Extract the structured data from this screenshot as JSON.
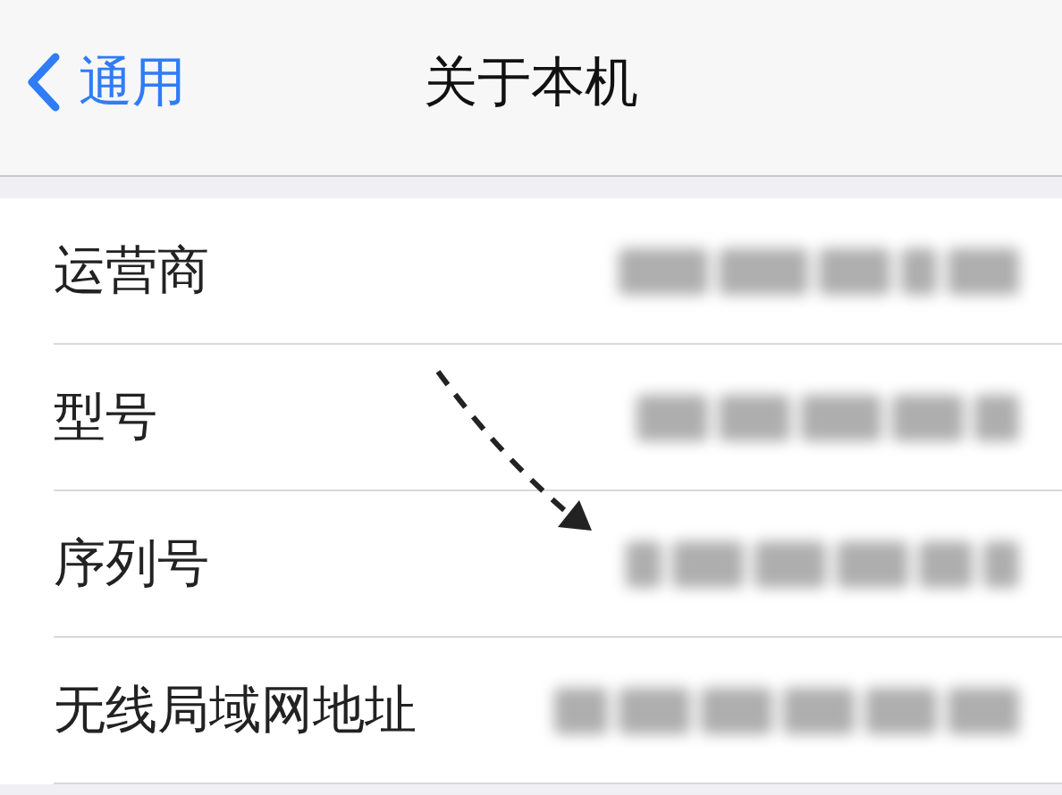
{
  "nav": {
    "back": "通用",
    "title": "关于本机"
  },
  "rows": [
    {
      "label": "运营商",
      "redacted": true,
      "pointed": false
    },
    {
      "label": "型号",
      "redacted": true,
      "pointed": false
    },
    {
      "label": "序列号",
      "redacted": true,
      "pointed": true
    },
    {
      "label": "无线局域网地址",
      "redacted": true,
      "pointed": false
    }
  ]
}
